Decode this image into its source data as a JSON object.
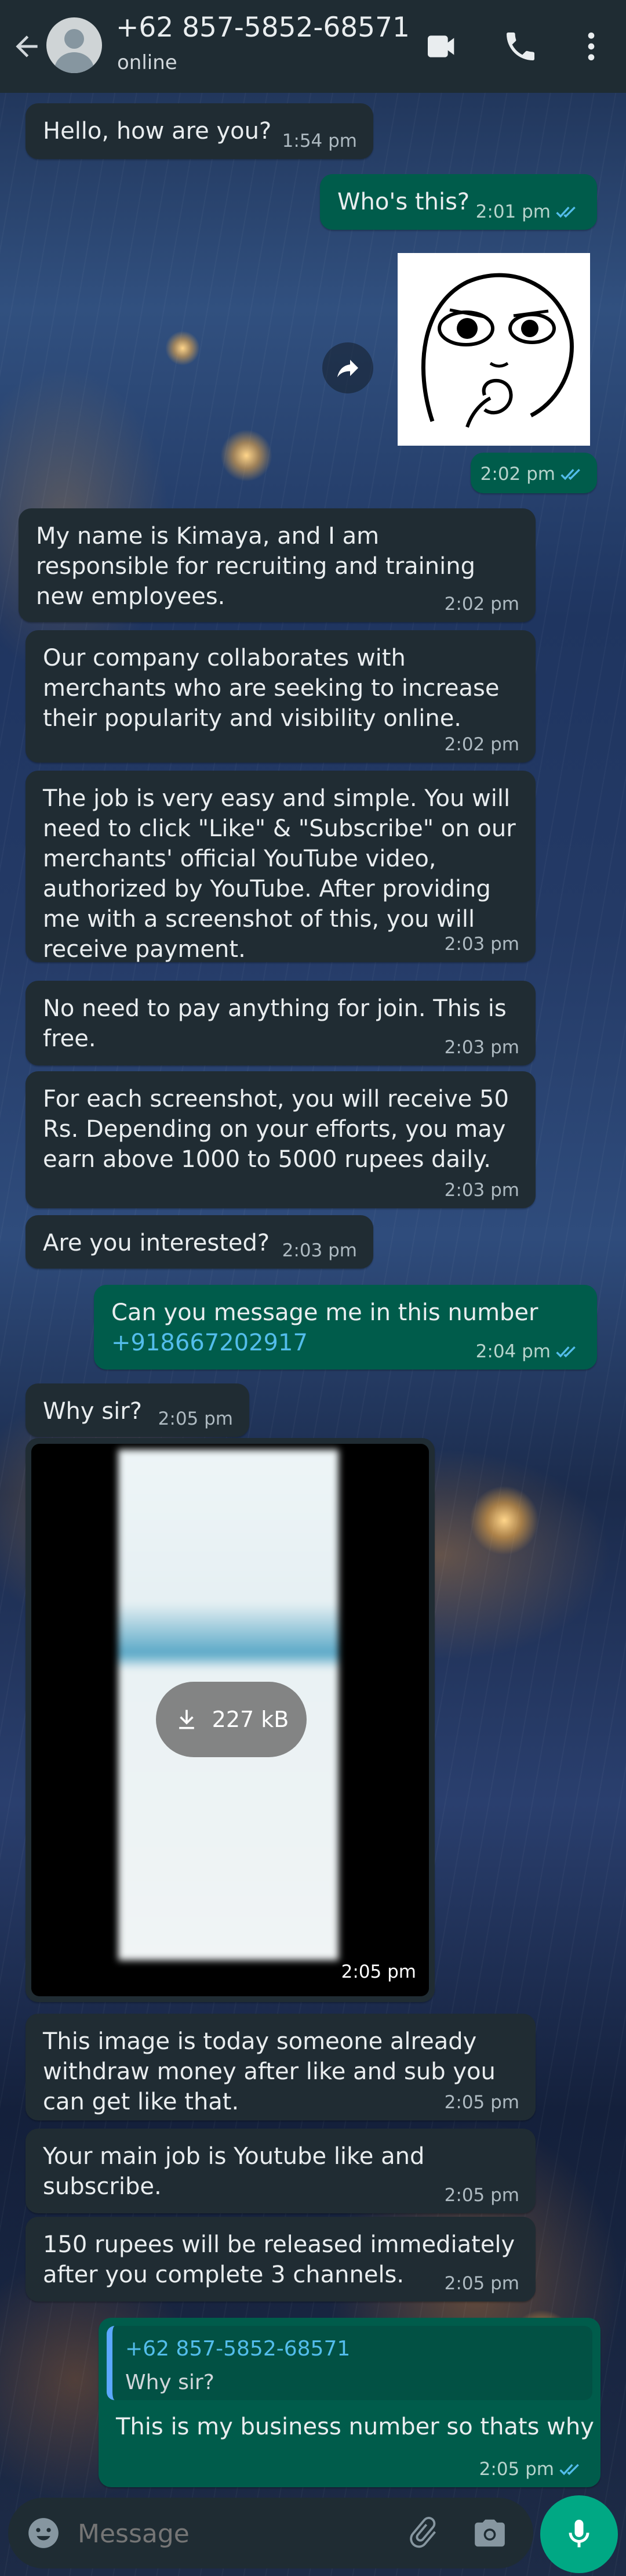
{
  "header": {
    "contact_name": "+62 857-5852-68571",
    "status": "online",
    "icons": [
      "back-arrow-icon",
      "avatar-placeholder",
      "video-call-icon",
      "phone-call-icon",
      "more-vert-icon"
    ]
  },
  "messages": [
    {
      "dir": "in",
      "text": "Hello, how are you?",
      "time": "1:54 pm"
    },
    {
      "dir": "out",
      "text": "Who's this?",
      "time": "2:01 pm",
      "read": true
    },
    {
      "dir": "out",
      "type": "sticker",
      "time": "2:02 pm",
      "read": true
    },
    {
      "dir": "in",
      "text": "My name is Kimaya, and I am responsible for recruiting and training new employees.",
      "time": "2:02 pm"
    },
    {
      "dir": "in",
      "text": "Our company collaborates with merchants who are seeking to increase their popularity and visibility online.",
      "time": "2:02 pm"
    },
    {
      "dir": "in",
      "text": "The job is very easy and simple. You will need to click \"Like\" & \"Subscribe\" on our merchants' official YouTube video, authorized by YouTube. After providing me with a screenshot of this, you will receive payment.",
      "time": "2:03 pm"
    },
    {
      "dir": "in",
      "text": "No need to pay anything for join. This is free.",
      "time": "2:03 pm"
    },
    {
      "dir": "in",
      "text": "For each screenshot, you will receive 50 Rs. Depending on your efforts, you may earn above 1000 to 5000 rupees daily.",
      "time": "2:03 pm"
    },
    {
      "dir": "in",
      "text": "Are you interested?",
      "time": "2:03 pm"
    },
    {
      "dir": "out",
      "text": "Can you message me in this number",
      "link": "+918667202917",
      "time": "2:04 pm",
      "read": true
    },
    {
      "dir": "in",
      "text": "Why sir?",
      "time": "2:05 pm"
    },
    {
      "dir": "in",
      "type": "image",
      "size": "227 kB",
      "time": "2:05 pm"
    },
    {
      "dir": "in",
      "text": "This image is today someone already withdraw money after like and sub you can get like that.",
      "time": "2:05 pm"
    },
    {
      "dir": "in",
      "text": "Your main job is Youtube like and subscribe.",
      "time": "2:05 pm"
    },
    {
      "dir": "in",
      "text": "150 rupees will be released immediately after you complete 3 channels.",
      "time": "2:05 pm"
    },
    {
      "dir": "out",
      "quote_name": "+62 857-5852-68571",
      "quote_text": "Why sir?",
      "text": "This is my business number so thats why",
      "time": "2:05 pm",
      "read": true
    }
  ],
  "input": {
    "placeholder": "Message",
    "icons": [
      "emoji-icon",
      "attach-icon",
      "camera-icon",
      "mic-icon"
    ]
  },
  "colors": {
    "header_bg": "#1f2c33",
    "incoming_bubble": "#202c33",
    "outgoing_bubble": "#005c4b",
    "read_tick": "#53bdeb",
    "link": "#53bdeb",
    "mic_button": "#00a884"
  }
}
